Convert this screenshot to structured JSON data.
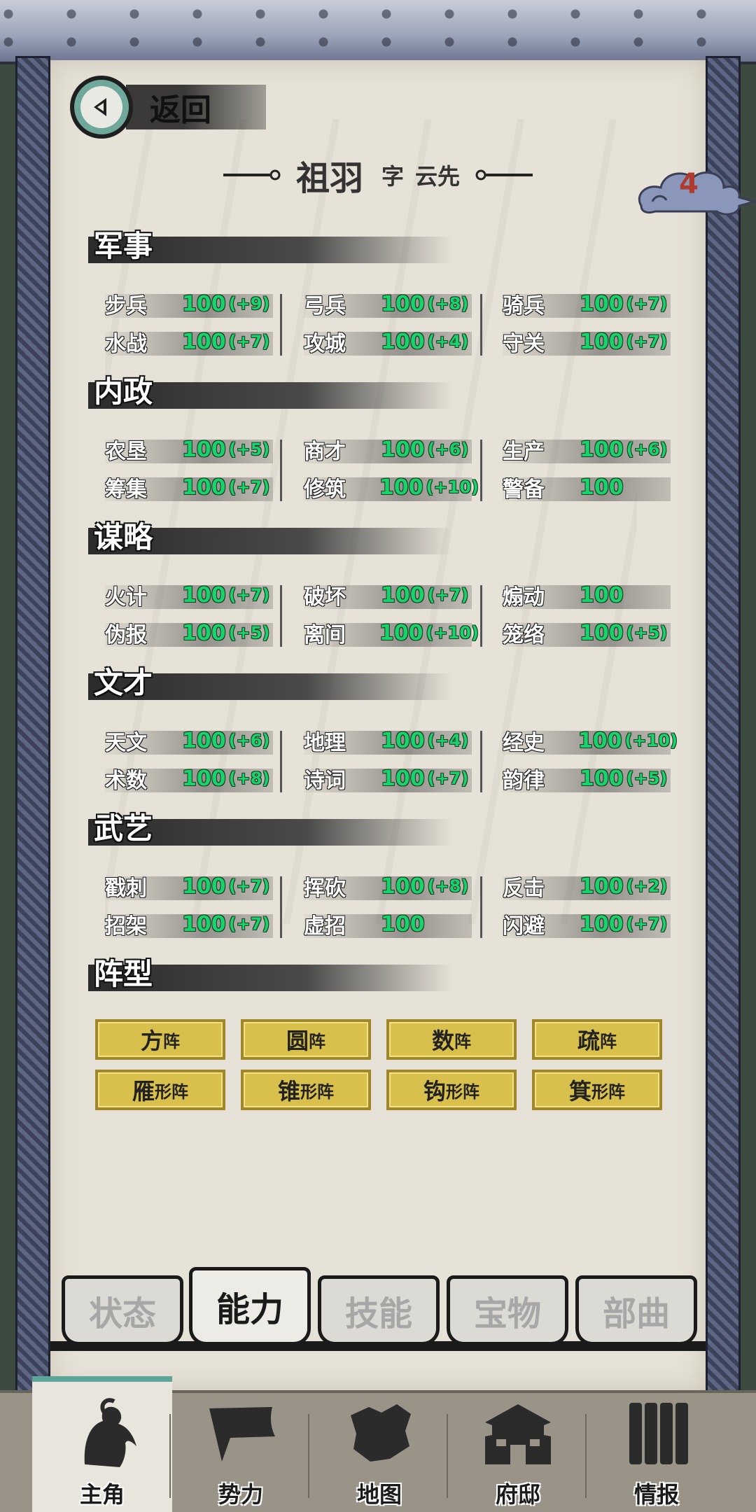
{
  "header": {
    "back_label": "返回",
    "badge_count": "4"
  },
  "character": {
    "name": "祖羽",
    "courtesy_prefix": "字",
    "courtesy_name": "云先"
  },
  "sections": [
    {
      "title": "军事",
      "stats": [
        {
          "name": "步兵",
          "value": "100",
          "bonus": "(+9)"
        },
        {
          "name": "弓兵",
          "value": "100",
          "bonus": "(+8)"
        },
        {
          "name": "骑兵",
          "value": "100",
          "bonus": "(+7)"
        },
        {
          "name": "水战",
          "value": "100",
          "bonus": "(+7)"
        },
        {
          "name": "攻城",
          "value": "100",
          "bonus": "(+4)"
        },
        {
          "name": "守关",
          "value": "100",
          "bonus": "(+7)"
        }
      ]
    },
    {
      "title": "内政",
      "stats": [
        {
          "name": "农垦",
          "value": "100",
          "bonus": "(+5)"
        },
        {
          "name": "商才",
          "value": "100",
          "bonus": "(+6)"
        },
        {
          "name": "生产",
          "value": "100",
          "bonus": "(+6)"
        },
        {
          "name": "筹集",
          "value": "100",
          "bonus": "(+7)"
        },
        {
          "name": "修筑",
          "value": "100",
          "bonus": "(+10)"
        },
        {
          "name": "警备",
          "value": "100",
          "bonus": ""
        }
      ]
    },
    {
      "title": "谋略",
      "stats": [
        {
          "name": "火计",
          "value": "100",
          "bonus": "(+7)"
        },
        {
          "name": "破坏",
          "value": "100",
          "bonus": "(+7)"
        },
        {
          "name": "煽动",
          "value": "100",
          "bonus": ""
        },
        {
          "name": "伪报",
          "value": "100",
          "bonus": "(+5)"
        },
        {
          "name": "离间",
          "value": "100",
          "bonus": "(+10)"
        },
        {
          "name": "笼络",
          "value": "100",
          "bonus": "(+5)"
        }
      ]
    },
    {
      "title": "文才",
      "stats": [
        {
          "name": "天文",
          "value": "100",
          "bonus": "(+6)"
        },
        {
          "name": "地理",
          "value": "100",
          "bonus": "(+4)"
        },
        {
          "name": "经史",
          "value": "100",
          "bonus": "(+10)"
        },
        {
          "name": "术数",
          "value": "100",
          "bonus": "(+8)"
        },
        {
          "name": "诗词",
          "value": "100",
          "bonus": "(+7)"
        },
        {
          "name": "韵律",
          "value": "100",
          "bonus": "(+5)"
        }
      ]
    },
    {
      "title": "武艺",
      "stats": [
        {
          "name": "戳刺",
          "value": "100",
          "bonus": "(+7)"
        },
        {
          "name": "挥砍",
          "value": "100",
          "bonus": "(+8)"
        },
        {
          "name": "反击",
          "value": "100",
          "bonus": "(+2)"
        },
        {
          "name": "招架",
          "value": "100",
          "bonus": "(+7)"
        },
        {
          "name": "虚招",
          "value": "100",
          "bonus": ""
        },
        {
          "name": "闪避",
          "value": "100",
          "bonus": "(+7)"
        }
      ]
    }
  ],
  "formation_section": {
    "title": "阵型",
    "items": [
      {
        "main": "方",
        "suffix": "阵"
      },
      {
        "main": "圆",
        "suffix": "阵"
      },
      {
        "main": "数",
        "suffix": "阵"
      },
      {
        "main": "疏",
        "suffix": "阵"
      },
      {
        "main": "雁",
        "suffix": "形阵"
      },
      {
        "main": "锥",
        "suffix": "形阵"
      },
      {
        "main": "钩",
        "suffix": "形阵"
      },
      {
        "main": "箕",
        "suffix": "形阵"
      }
    ]
  },
  "tabs": [
    {
      "label": "状态",
      "active": false
    },
    {
      "label": "能力",
      "active": true
    },
    {
      "label": "技能",
      "active": false
    },
    {
      "label": "宝物",
      "active": false
    },
    {
      "label": "部曲",
      "active": false
    }
  ],
  "bottom_nav": [
    {
      "label": "主角",
      "icon": "hero-icon",
      "active": true
    },
    {
      "label": "势力",
      "icon": "flag-icon",
      "active": false
    },
    {
      "label": "地图",
      "icon": "map-icon",
      "active": false
    },
    {
      "label": "府邸",
      "icon": "mansion-icon",
      "active": false
    },
    {
      "label": "情报",
      "icon": "scroll-icon",
      "active": false
    }
  ],
  "colors": {
    "stat_value": "#17d36b",
    "badge_number": "#b03a2e",
    "formation_gold": "#d9c04c",
    "accent_teal": "#6fa89a"
  }
}
